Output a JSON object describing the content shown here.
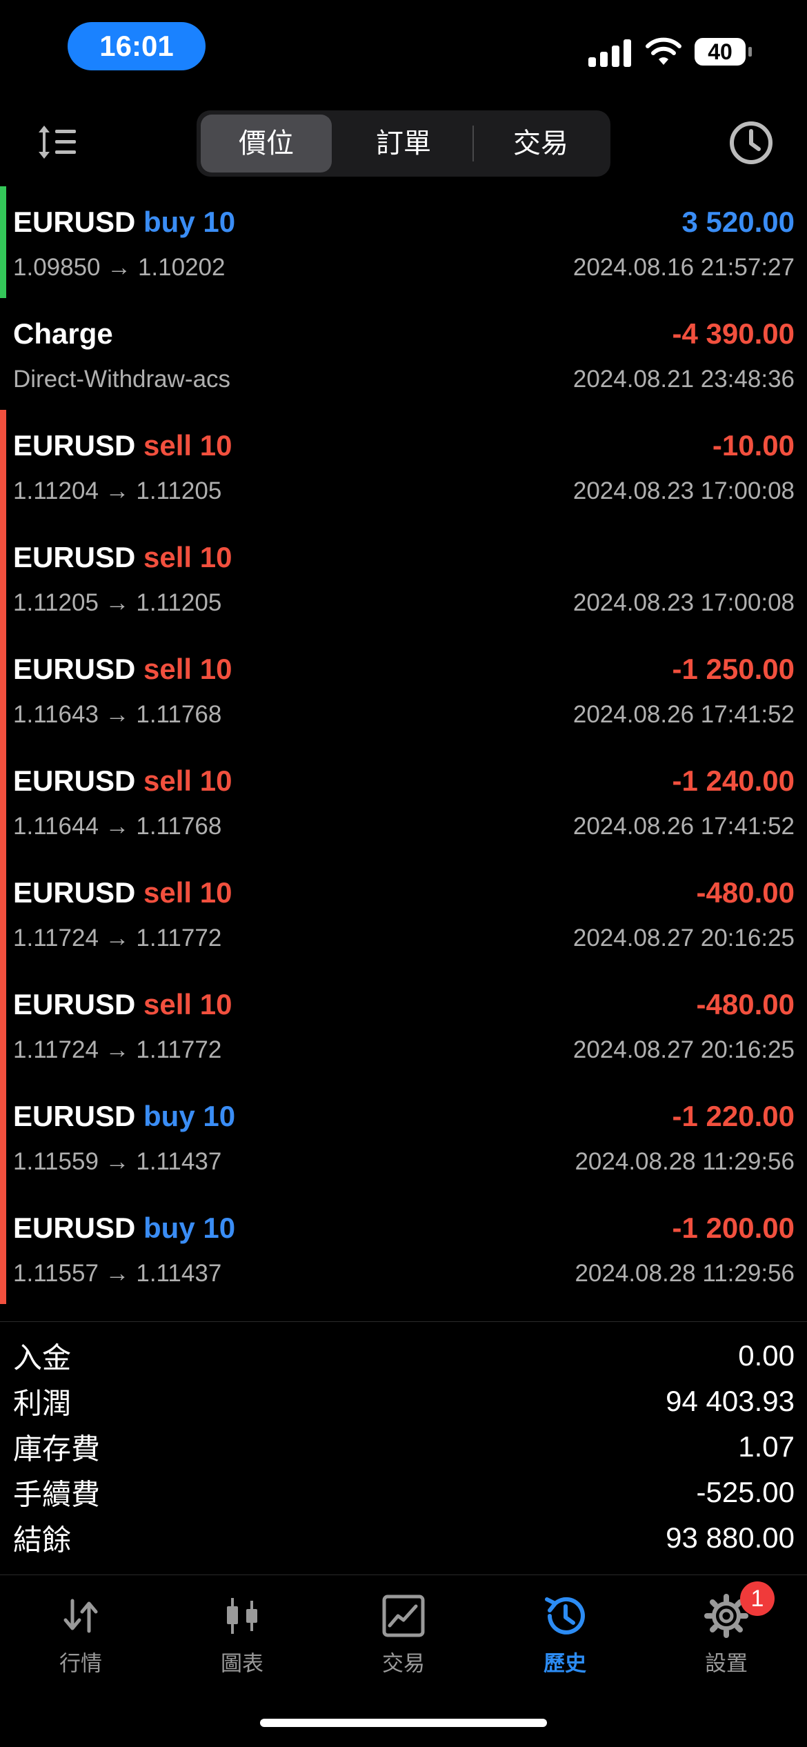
{
  "status_bar": {
    "time": "16:01",
    "battery": "40"
  },
  "header": {
    "tabs": [
      {
        "label": "價位",
        "active": true
      },
      {
        "label": "訂單",
        "active": false
      },
      {
        "label": "交易",
        "active": false
      }
    ]
  },
  "colors": {
    "buy": "#3a8df5",
    "sell": "#f2503e",
    "accent": "#2c8cf4",
    "bar_green": "#34c759",
    "bar_red": "#f2503e"
  },
  "rows": [
    {
      "symbol": "EURUSD",
      "side": "buy 10",
      "side_type": "buy",
      "amount": "3 520.00",
      "amount_sign": "pos",
      "sub": "1.09850 → 1.10202",
      "time": "2024.08.16 21:57:27",
      "bar": "green"
    },
    {
      "symbol": "Charge",
      "side": "",
      "side_type": "",
      "amount": "-4 390.00",
      "amount_sign": "neg",
      "sub": "Direct-Withdraw-acs",
      "time": "2024.08.21 23:48:36",
      "bar": "none"
    },
    {
      "symbol": "EURUSD",
      "side": "sell 10",
      "side_type": "sell",
      "amount": "-10.00",
      "amount_sign": "neg",
      "sub": "1.11204 → 1.11205",
      "time": "2024.08.23 17:00:08",
      "bar": "red"
    },
    {
      "symbol": "EURUSD",
      "side": "sell 10",
      "side_type": "sell",
      "amount": "",
      "amount_sign": "neg",
      "sub": "1.11205 → 1.11205",
      "time": "2024.08.23 17:00:08",
      "bar": "red"
    },
    {
      "symbol": "EURUSD",
      "side": "sell 10",
      "side_type": "sell",
      "amount": "-1 250.00",
      "amount_sign": "neg",
      "sub": "1.11643 → 1.11768",
      "time": "2024.08.26 17:41:52",
      "bar": "red"
    },
    {
      "symbol": "EURUSD",
      "side": "sell 10",
      "side_type": "sell",
      "amount": "-1 240.00",
      "amount_sign": "neg",
      "sub": "1.11644 → 1.11768",
      "time": "2024.08.26 17:41:52",
      "bar": "red"
    },
    {
      "symbol": "EURUSD",
      "side": "sell 10",
      "side_type": "sell",
      "amount": "-480.00",
      "amount_sign": "neg",
      "sub": "1.11724 → 1.11772",
      "time": "2024.08.27 20:16:25",
      "bar": "red"
    },
    {
      "symbol": "EURUSD",
      "side": "sell 10",
      "side_type": "sell",
      "amount": "-480.00",
      "amount_sign": "neg",
      "sub": "1.11724 → 1.11772",
      "time": "2024.08.27 20:16:25",
      "bar": "red"
    },
    {
      "symbol": "EURUSD",
      "side": "buy 10",
      "side_type": "buy",
      "amount": "-1 220.00",
      "amount_sign": "neg",
      "sub": "1.11559 → 1.11437",
      "time": "2024.08.28 11:29:56",
      "bar": "red"
    },
    {
      "symbol": "EURUSD",
      "side": "buy 10",
      "side_type": "buy",
      "amount": "-1 200.00",
      "amount_sign": "neg",
      "sub": "1.11557 → 1.11437",
      "time": "2024.08.28 11:29:56",
      "bar": "red"
    }
  ],
  "summary": [
    {
      "label": "入金",
      "value": "0.00"
    },
    {
      "label": "利潤",
      "value": "94 403.93"
    },
    {
      "label": "庫存費",
      "value": "1.07"
    },
    {
      "label": "手續費",
      "value": "-525.00"
    },
    {
      "label": "結餘",
      "value": "93 880.00"
    }
  ],
  "tabbar": {
    "items": [
      {
        "label": "行情",
        "icon": "quotes-arrows-icon",
        "active": false
      },
      {
        "label": "圖表",
        "icon": "candlestick-chart-icon",
        "active": false
      },
      {
        "label": "交易",
        "icon": "trade-chart-icon",
        "active": false
      },
      {
        "label": "歷史",
        "icon": "history-clock-icon",
        "active": true
      },
      {
        "label": "設置",
        "icon": "settings-gear-icon",
        "active": false
      }
    ],
    "settings_badge": "1"
  }
}
